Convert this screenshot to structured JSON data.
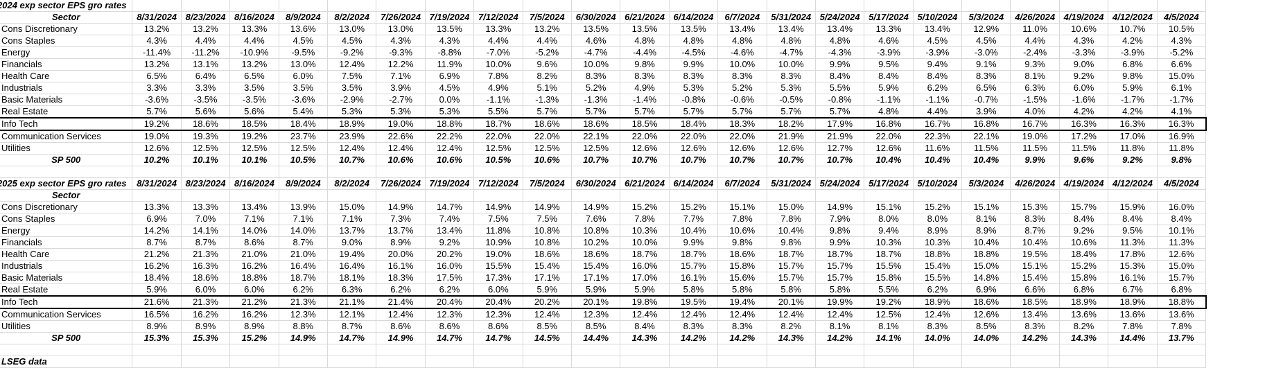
{
  "dates": [
    "8/31/2024",
    "8/23/2024",
    "8/16/2024",
    "8/9/2024",
    "8/2/2024",
    "7/26/2024",
    "7/19/2024",
    "7/12/2024",
    "7/5/2024",
    "6/30/2024",
    "6/21/2024",
    "6/14/2024",
    "6/7/2024",
    "5/31/2024",
    "5/24/2024",
    "5/17/2024",
    "5/10/2024",
    "5/3/2024",
    "4/26/2024",
    "4/19/2024",
    "4/12/2024",
    "4/5/2024"
  ],
  "sector_header": "Sector",
  "source_note": "LSEG data",
  "sections": [
    {
      "title": "2024 exp sector EPS gro rates",
      "rows": [
        {
          "sector": "Cons Discretionary",
          "values": [
            "13.2%",
            "13.2%",
            "13.3%",
            "13.6%",
            "13.0%",
            "13.0%",
            "13.5%",
            "13.3%",
            "13.2%",
            "13.5%",
            "13.5%",
            "13.5%",
            "13.4%",
            "13.4%",
            "13.4%",
            "13.3%",
            "13.4%",
            "12.9%",
            "11.0%",
            "10.6%",
            "10.7%",
            "10.5%"
          ]
        },
        {
          "sector": "Cons Staples",
          "values": [
            "4.3%",
            "4.4%",
            "4.4%",
            "4.5%",
            "4.5%",
            "4.3%",
            "4.3%",
            "4.4%",
            "4.4%",
            "4.6%",
            "4.8%",
            "4.8%",
            "4.8%",
            "4.8%",
            "4.8%",
            "4.6%",
            "4.5%",
            "4.5%",
            "4.4%",
            "4.3%",
            "4.2%",
            "4.3%"
          ]
        },
        {
          "sector": "Energy",
          "values": [
            "-11.4%",
            "-11.2%",
            "-10.9%",
            "-9.5%",
            "-9.2%",
            "-9.3%",
            "-8.8%",
            "-7.0%",
            "-5.2%",
            "-4.7%",
            "-4.4%",
            "-4.5%",
            "-4.6%",
            "-4.7%",
            "-4.3%",
            "-3.9%",
            "-3.9%",
            "-3.0%",
            "-2.4%",
            "-3.3%",
            "-3.9%",
            "-5.2%"
          ]
        },
        {
          "sector": "Financials",
          "values": [
            "13.2%",
            "13.1%",
            "13.2%",
            "13.0%",
            "12.4%",
            "12.2%",
            "11.9%",
            "10.0%",
            "9.6%",
            "10.0%",
            "9.8%",
            "9.9%",
            "10.0%",
            "10.0%",
            "9.9%",
            "9.5%",
            "9.4%",
            "9.1%",
            "9.3%",
            "9.0%",
            "6.8%",
            "6.6%"
          ]
        },
        {
          "sector": "Health Care",
          "values": [
            "6.5%",
            "6.4%",
            "6.5%",
            "6.0%",
            "7.5%",
            "7.1%",
            "6.9%",
            "7.8%",
            "8.2%",
            "8.3%",
            "8.3%",
            "8.3%",
            "8.3%",
            "8.3%",
            "8.4%",
            "8.4%",
            "8.4%",
            "8.3%",
            "8.1%",
            "9.2%",
            "9.8%",
            "15.0%"
          ]
        },
        {
          "sector": "Industrials",
          "values": [
            "3.3%",
            "3.3%",
            "3.5%",
            "3.5%",
            "3.5%",
            "3.9%",
            "4.5%",
            "4.9%",
            "5.1%",
            "5.2%",
            "4.9%",
            "5.3%",
            "5.2%",
            "5.3%",
            "5.5%",
            "5.9%",
            "6.2%",
            "6.5%",
            "6.3%",
            "6.0%",
            "5.9%",
            "6.1%"
          ]
        },
        {
          "sector": "Basic Materials",
          "values": [
            "-3.6%",
            "-3.5%",
            "-3.5%",
            "-3.6%",
            "-2.9%",
            "-2.7%",
            "0.0%",
            "-1.1%",
            "-1.3%",
            "-1.3%",
            "-1.4%",
            "-0.8%",
            "-0.6%",
            "-0.5%",
            "-0.8%",
            "-1.1%",
            "-1.1%",
            "-0.7%",
            "-1.5%",
            "-1.6%",
            "-1.7%",
            "-1.7%"
          ]
        },
        {
          "sector": "Real Estate",
          "values": [
            "5.7%",
            "5.6%",
            "5.6%",
            "5.4%",
            "5.3%",
            "5.3%",
            "5.3%",
            "5.5%",
            "5.7%",
            "5.7%",
            "5.7%",
            "5.7%",
            "5.7%",
            "5.7%",
            "5.7%",
            "4.8%",
            "4.4%",
            "3.9%",
            "4.0%",
            "4.2%",
            "4.2%",
            "4.1%"
          ]
        },
        {
          "sector": "Info Tech",
          "highlight": true,
          "values": [
            "19.2%",
            "18.6%",
            "18.5%",
            "18.4%",
            "18.9%",
            "19.0%",
            "18.8%",
            "18.7%",
            "18.6%",
            "18.6%",
            "18.5%",
            "18.4%",
            "18.3%",
            "18.2%",
            "17.9%",
            "16.8%",
            "16.7%",
            "16.8%",
            "16.7%",
            "16.3%",
            "16.3%",
            "16.3%"
          ]
        },
        {
          "sector": "Communication Services",
          "values": [
            "19.0%",
            "19.3%",
            "19.2%",
            "23.7%",
            "23.9%",
            "22.6%",
            "22.2%",
            "22.0%",
            "22.0%",
            "22.1%",
            "22.0%",
            "22.0%",
            "22.0%",
            "21.9%",
            "21.9%",
            "22.0%",
            "22.3%",
            "22.1%",
            "19.0%",
            "17.2%",
            "17.0%",
            "16.9%"
          ]
        },
        {
          "sector": "Utilities",
          "values": [
            "12.6%",
            "12.5%",
            "12.5%",
            "12.5%",
            "12.4%",
            "12.4%",
            "12.4%",
            "12.5%",
            "12.5%",
            "12.5%",
            "12.6%",
            "12.6%",
            "12.6%",
            "12.6%",
            "12.7%",
            "12.6%",
            "11.6%",
            "11.5%",
            "11.5%",
            "11.5%",
            "11.8%",
            "11.8%"
          ]
        },
        {
          "sector": "SP 500",
          "total": true,
          "values": [
            "10.2%",
            "10.1%",
            "10.1%",
            "10.5%",
            "10.7%",
            "10.6%",
            "10.6%",
            "10.5%",
            "10.6%",
            "10.7%",
            "10.7%",
            "10.7%",
            "10.7%",
            "10.7%",
            "10.7%",
            "10.4%",
            "10.4%",
            "10.4%",
            "9.9%",
            "9.6%",
            "9.2%",
            "9.8%"
          ]
        }
      ]
    },
    {
      "title": "2025 exp sector EPS gro rates",
      "rows": [
        {
          "sector": "Cons Discretionary",
          "values": [
            "13.3%",
            "13.3%",
            "13.4%",
            "13.9%",
            "15.0%",
            "14.9%",
            "14.7%",
            "14.9%",
            "14.9%",
            "14.9%",
            "15.2%",
            "15.2%",
            "15.1%",
            "15.0%",
            "14.9%",
            "15.1%",
            "15.2%",
            "15.1%",
            "15.3%",
            "15.7%",
            "15.9%",
            "16.0%"
          ]
        },
        {
          "sector": "Cons Staples",
          "values": [
            "6.9%",
            "7.0%",
            "7.1%",
            "7.1%",
            "7.1%",
            "7.3%",
            "7.4%",
            "7.5%",
            "7.5%",
            "7.6%",
            "7.8%",
            "7.7%",
            "7.8%",
            "7.8%",
            "7.9%",
            "8.0%",
            "8.0%",
            "8.1%",
            "8.3%",
            "8.4%",
            "8.4%",
            "8.4%"
          ]
        },
        {
          "sector": "Energy",
          "values": [
            "14.2%",
            "14.1%",
            "14.0%",
            "14.0%",
            "13.7%",
            "13.7%",
            "13.4%",
            "11.8%",
            "10.8%",
            "10.8%",
            "10.3%",
            "10.4%",
            "10.6%",
            "10.4%",
            "9.8%",
            "9.4%",
            "8.9%",
            "8.9%",
            "8.7%",
            "9.2%",
            "9.5%",
            "10.1%"
          ]
        },
        {
          "sector": "Financials",
          "values": [
            "8.7%",
            "8.7%",
            "8.6%",
            "8.7%",
            "9.0%",
            "8.9%",
            "9.2%",
            "10.9%",
            "10.8%",
            "10.2%",
            "10.0%",
            "9.9%",
            "9.8%",
            "9.8%",
            "9.9%",
            "10.3%",
            "10.3%",
            "10.4%",
            "10.4%",
            "10.6%",
            "11.3%",
            "11.3%"
          ]
        },
        {
          "sector": "Health Care",
          "values": [
            "21.2%",
            "21.3%",
            "21.0%",
            "21.0%",
            "19.4%",
            "20.0%",
            "20.2%",
            "19.0%",
            "18.6%",
            "18.6%",
            "18.7%",
            "18.7%",
            "18.6%",
            "18.7%",
            "18.7%",
            "18.7%",
            "18.8%",
            "18.8%",
            "19.5%",
            "18.4%",
            "17.8%",
            "12.6%"
          ]
        },
        {
          "sector": "Industrials",
          "values": [
            "16.2%",
            "16.3%",
            "16.2%",
            "16.4%",
            "16.4%",
            "16.1%",
            "16.0%",
            "15.5%",
            "15.4%",
            "15.4%",
            "16.0%",
            "15.7%",
            "15.8%",
            "15.7%",
            "15.7%",
            "15.5%",
            "15.4%",
            "15.0%",
            "15.1%",
            "15.2%",
            "15.3%",
            "15.0%"
          ]
        },
        {
          "sector": "Basic Materials",
          "values": [
            "18.4%",
            "18.6%",
            "18.8%",
            "18.7%",
            "18.1%",
            "18.3%",
            "17.5%",
            "17.3%",
            "17.1%",
            "17.1%",
            "17.0%",
            "16.1%",
            "15.6%",
            "15.7%",
            "15.7%",
            "15.8%",
            "15.5%",
            "14.8%",
            "15.4%",
            "15.8%",
            "16.1%",
            "15.7%"
          ]
        },
        {
          "sector": "Real Estate",
          "values": [
            "5.9%",
            "6.0%",
            "6.0%",
            "6.2%",
            "6.3%",
            "6.2%",
            "6.2%",
            "6.0%",
            "5.9%",
            "5.9%",
            "5.9%",
            "5.8%",
            "5.8%",
            "5.8%",
            "5.8%",
            "5.5%",
            "6.2%",
            "6.9%",
            "6.6%",
            "6.8%",
            "6.7%",
            "6.8%"
          ]
        },
        {
          "sector": "Info Tech",
          "highlight": true,
          "values": [
            "21.6%",
            "21.3%",
            "21.2%",
            "21.3%",
            "21.1%",
            "21.4%",
            "20.4%",
            "20.4%",
            "20.2%",
            "20.1%",
            "19.8%",
            "19.5%",
            "19.4%",
            "20.1%",
            "19.9%",
            "19.2%",
            "18.9%",
            "18.6%",
            "18.5%",
            "18.9%",
            "18.9%",
            "18.8%"
          ]
        },
        {
          "sector": "Communication Services",
          "values": [
            "16.5%",
            "16.2%",
            "16.2%",
            "12.3%",
            "12.1%",
            "12.4%",
            "12.3%",
            "12.3%",
            "12.4%",
            "12.3%",
            "12.4%",
            "12.4%",
            "12.4%",
            "12.4%",
            "12.4%",
            "12.5%",
            "12.4%",
            "12.6%",
            "13.4%",
            "13.6%",
            "13.6%",
            "13.6%"
          ]
        },
        {
          "sector": "Utilities",
          "values": [
            "8.9%",
            "8.9%",
            "8.9%",
            "8.8%",
            "8.7%",
            "8.6%",
            "8.6%",
            "8.6%",
            "8.5%",
            "8.5%",
            "8.4%",
            "8.3%",
            "8.3%",
            "8.2%",
            "8.1%",
            "8.1%",
            "8.3%",
            "8.5%",
            "8.3%",
            "8.2%",
            "7.8%",
            "7.8%"
          ]
        },
        {
          "sector": "SP 500",
          "total": true,
          "values": [
            "15.3%",
            "15.3%",
            "15.2%",
            "14.9%",
            "14.7%",
            "14.9%",
            "14.7%",
            "14.7%",
            "14.5%",
            "14.4%",
            "14.3%",
            "14.2%",
            "14.2%",
            "14.3%",
            "14.2%",
            "14.1%",
            "14.0%",
            "14.0%",
            "14.2%",
            "14.3%",
            "14.4%",
            "13.7%"
          ]
        }
      ]
    }
  ]
}
